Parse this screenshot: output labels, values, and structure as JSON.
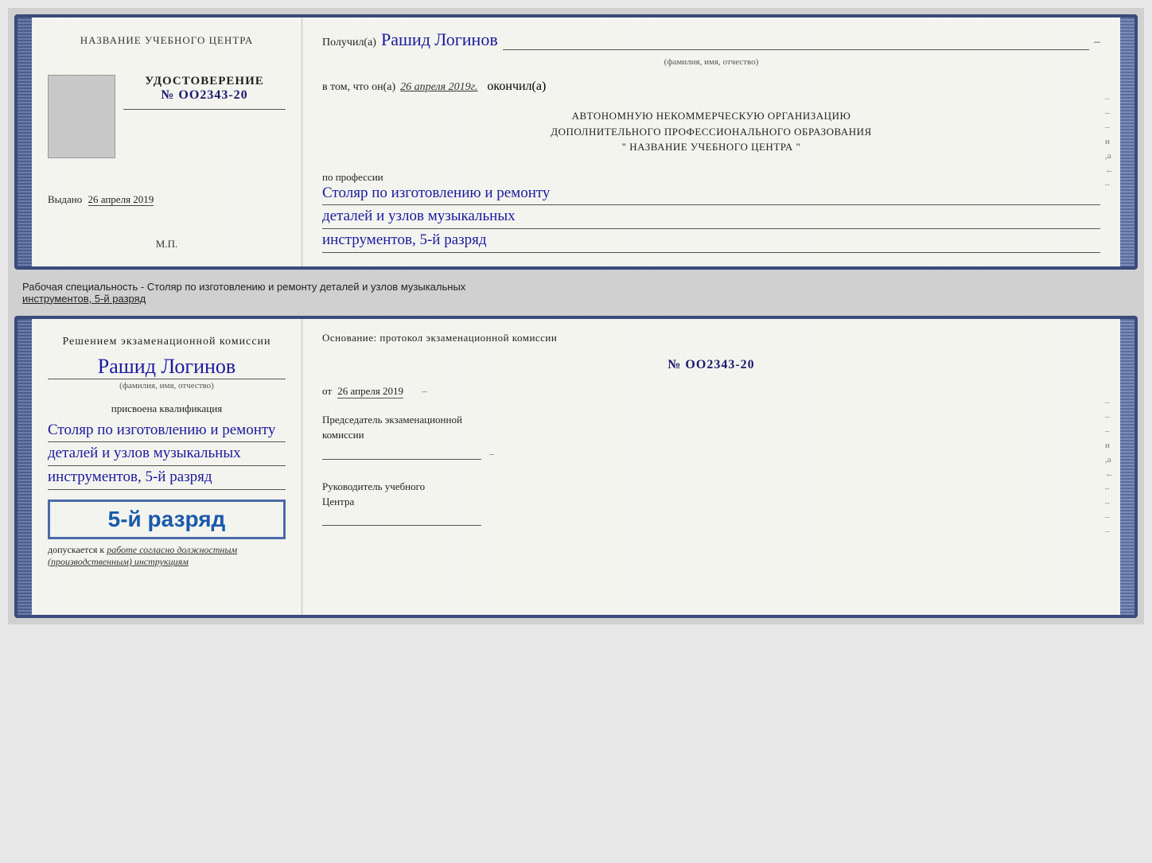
{
  "page": {
    "background": "#d0d0d0"
  },
  "top_card": {
    "left": {
      "center_name_label": "НАЗВАНИЕ УЧЕБНОГО ЦЕНТРА",
      "udostoverenie_label": "УДОСТОВЕРЕНИЕ",
      "number": "№ OO2343-20",
      "issued_label": "Выдано",
      "issued_date": "26 апреля 2019",
      "mp_label": "М.П."
    },
    "right": {
      "received_prefix": "Получил(а)",
      "recipient_name": "Рашид Логинов",
      "name_label": "(фамилия, имя, отчество)",
      "in_that_prefix": "в том, что он(а)",
      "completion_date": "26 апреля 2019г.",
      "finished_label": "окончил(а)",
      "org_line1": "АВТОНОМНУЮ НЕКОММЕРЧЕСКУЮ ОРГАНИЗАЦИЮ",
      "org_line2": "ДОПОЛНИТЕЛЬНОГО ПРОФЕССИОНАЛЬНОГО ОБРАЗОВАНИЯ",
      "org_line3": "\"   НАЗВАНИЕ УЧЕБНОГО ЦЕНТРА   \"",
      "profession_prefix": "по профессии",
      "profession_line1": "Столяр по изготовлению и ремонту",
      "profession_line2": "деталей и узлов музыкальных",
      "profession_line3": "инструментов, 5-й разряд",
      "right_edge": [
        "–",
        "–",
        "–",
        "и",
        ",а",
        "←",
        "–"
      ]
    }
  },
  "separator": {
    "text_start": "Рабочая специальность - Столяр по изготовлению и ремонту деталей и узлов музыкальных",
    "text_underlined": "инструментов, 5-й разряд"
  },
  "bottom_card": {
    "left": {
      "decision_line1": "Решением  экзаменационной  комиссии",
      "person_name": "Рашид Логинов",
      "name_label": "(фамилия, имя, отчество)",
      "qualification_prefix": "присвоена квалификация",
      "qual_line1": "Столяр по изготовлению и ремонту",
      "qual_line2": "деталей и узлов музыкальных",
      "qual_line3": "инструментов, 5-й разряд",
      "stamp_text": "5-й разряд",
      "допускается_prefix": "допускается к",
      "допускается_text": "работе согласно должностным",
      "инструкциям_text": "(производственным) инструкциям"
    },
    "right": {
      "osnov_label": "Основание: протокол экзаменационной  комиссии",
      "proto_number": "№ OO2343-20",
      "date_prefix": "от",
      "date_value": "26 апреля 2019",
      "chairman_line1": "Председатель экзаменационной",
      "chairman_line2": "комиссии",
      "руководитель_line1": "Руководитель учебного",
      "руководитель_line2": "Центра",
      "right_edge": [
        "–",
        "–",
        "–",
        "и",
        ",а",
        "←",
        "–",
        "–",
        "–",
        "–"
      ]
    }
  }
}
